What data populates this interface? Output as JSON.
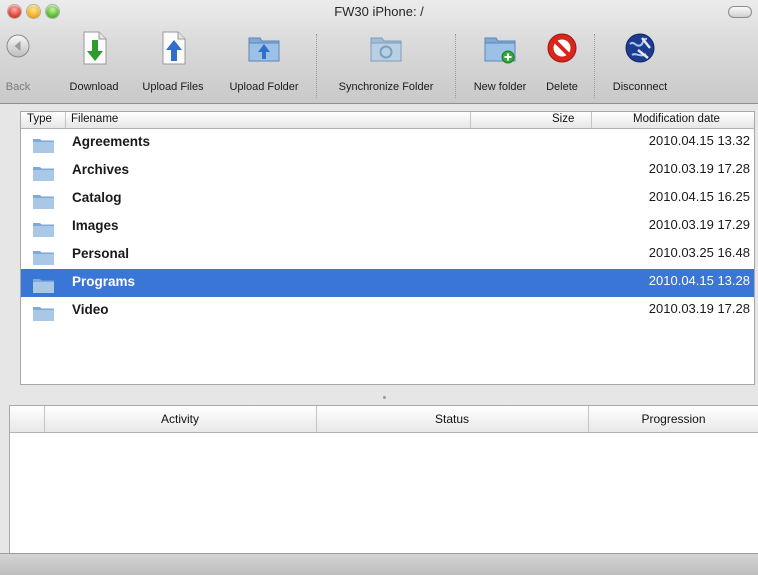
{
  "window": {
    "title": "FW30 iPhone: /"
  },
  "toolbar": {
    "back": "Back",
    "download": "Download",
    "upload_files": "Upload Files",
    "upload_folder": "Upload Folder",
    "synchronize": "Synchronize Folder",
    "new_folder": "New folder",
    "delete": "Delete",
    "disconnect": "Disconnect"
  },
  "files": {
    "columns": {
      "type": "Type",
      "filename": "Filename",
      "size": "Size",
      "modified": "Modification date"
    },
    "rows": [
      {
        "name": "Agreements",
        "date": "2010.04.15 13.32",
        "selected": false
      },
      {
        "name": "Archives",
        "date": "2010.03.19 17.28",
        "selected": false
      },
      {
        "name": "Catalog",
        "date": "2010.04.15 16.25",
        "selected": false
      },
      {
        "name": "Images",
        "date": "2010.03.19 17.29",
        "selected": false
      },
      {
        "name": "Personal",
        "date": "2010.03.25 16.48",
        "selected": false
      },
      {
        "name": "Programs",
        "date": "2010.04.15 13.28",
        "selected": true
      },
      {
        "name": "Video",
        "date": "2010.03.19 17.28",
        "selected": false
      }
    ]
  },
  "activity": {
    "columns": {
      "activity": "Activity",
      "status": "Status",
      "progression": "Progression"
    }
  },
  "colors": {
    "selection": "#3a76d6",
    "folder": "#8fb7de",
    "delete": "#d9261c",
    "arrow_green": "#2e9b2e",
    "arrow_blue": "#2f6fc9"
  }
}
